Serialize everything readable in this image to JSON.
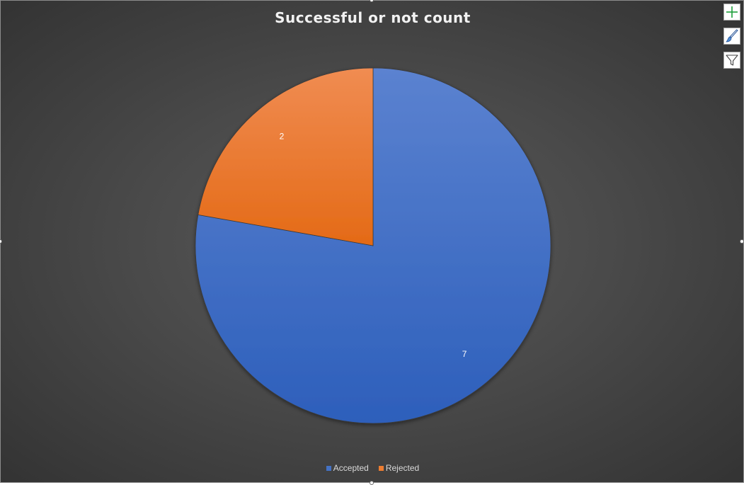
{
  "chart_data": {
    "type": "pie",
    "title": "Successful or not count",
    "categories": [
      "Accepted",
      "Rejected"
    ],
    "values": [
      7,
      2
    ],
    "colors": [
      "#4472c4",
      "#ed7d31"
    ],
    "data_labels": [
      "7",
      "2"
    ],
    "legend_position": "bottom",
    "start_angle_deg": 0,
    "direction": "clockwise"
  },
  "legend": {
    "items": [
      {
        "label": "Accepted",
        "color": "#4472c4"
      },
      {
        "label": "Rejected",
        "color": "#ed7d31"
      }
    ]
  },
  "tools": {
    "chart_elements_icon": "plus-icon",
    "chart_styles_icon": "brush-icon",
    "chart_filters_icon": "funnel-icon"
  },
  "colors": {
    "background": "#404040",
    "title": "#f2f2f2",
    "data_label": "#ffffff"
  }
}
